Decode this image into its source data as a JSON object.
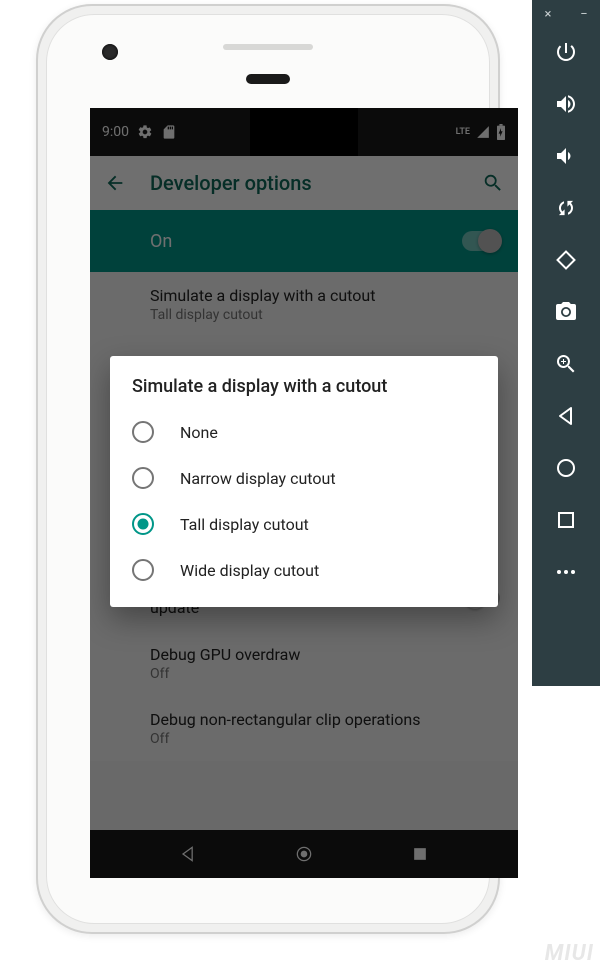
{
  "emulator": {
    "close": "×",
    "minimize": "−"
  },
  "status": {
    "time": "9:00",
    "lte": "LTE"
  },
  "appbar": {
    "title": "Developer options"
  },
  "toggle": {
    "label": "On"
  },
  "settings": {
    "cutout": {
      "title": "Simulate a display with a cutout",
      "sub": "Tall display cutout"
    },
    "hw_layers": {
      "title": "Flash hardware layers green when they update"
    },
    "gpu": {
      "title": "Debug GPU overdraw",
      "sub": "Off"
    },
    "clip": {
      "title": "Debug non-rectangular clip operations",
      "sub": "Off"
    }
  },
  "dialog": {
    "title": "Simulate a display with a cutout",
    "options": [
      {
        "label": "None",
        "selected": false
      },
      {
        "label": "Narrow display cutout",
        "selected": false
      },
      {
        "label": "Tall display cutout",
        "selected": true
      },
      {
        "label": "Wide display cutout",
        "selected": false
      }
    ]
  },
  "watermark": "MIUI"
}
